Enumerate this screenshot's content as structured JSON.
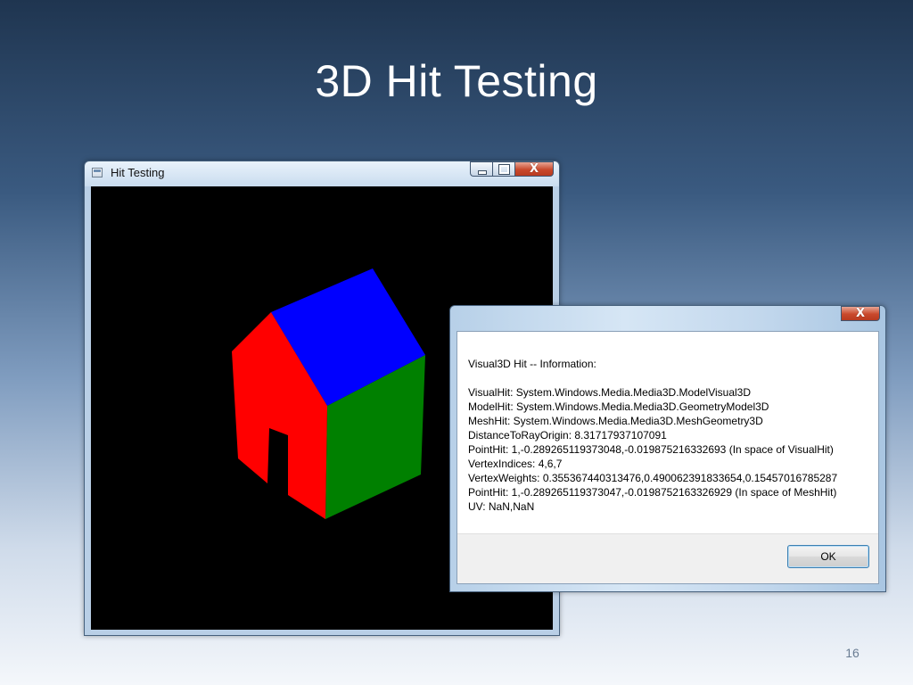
{
  "slide": {
    "title": "3D Hit Testing",
    "page_number": "16"
  },
  "main_window": {
    "title": "Hit Testing",
    "scene": {
      "roof_color": "#0000ff",
      "front_color": "#ff0000",
      "side_color": "#008000",
      "background_color": "#000000"
    }
  },
  "dialog": {
    "heading": "Visual3D Hit -- Information:",
    "lines": [
      "VisualHit: System.Windows.Media.Media3D.ModelVisual3D",
      "ModelHit: System.Windows.Media.Media3D.GeometryModel3D",
      "MeshHit: System.Windows.Media.Media3D.MeshGeometry3D",
      "DistanceToRayOrigin: 8.31717937107091",
      "PointHit: 1,-0.289265119373048,-0.019875216332693 (In space of VisualHit)",
      "VertexIndices: 4,6,7",
      "VertexWeights: 0.355367440313476,0.490062391833654,0.15457016785287",
      "PointHit: 1,-0.289265119373047,-0.0198752163326929 (In space of MeshHit)",
      "UV: NaN,NaN"
    ],
    "ok_label": "OK"
  },
  "caption_buttons": {
    "close_glyph": "X"
  }
}
